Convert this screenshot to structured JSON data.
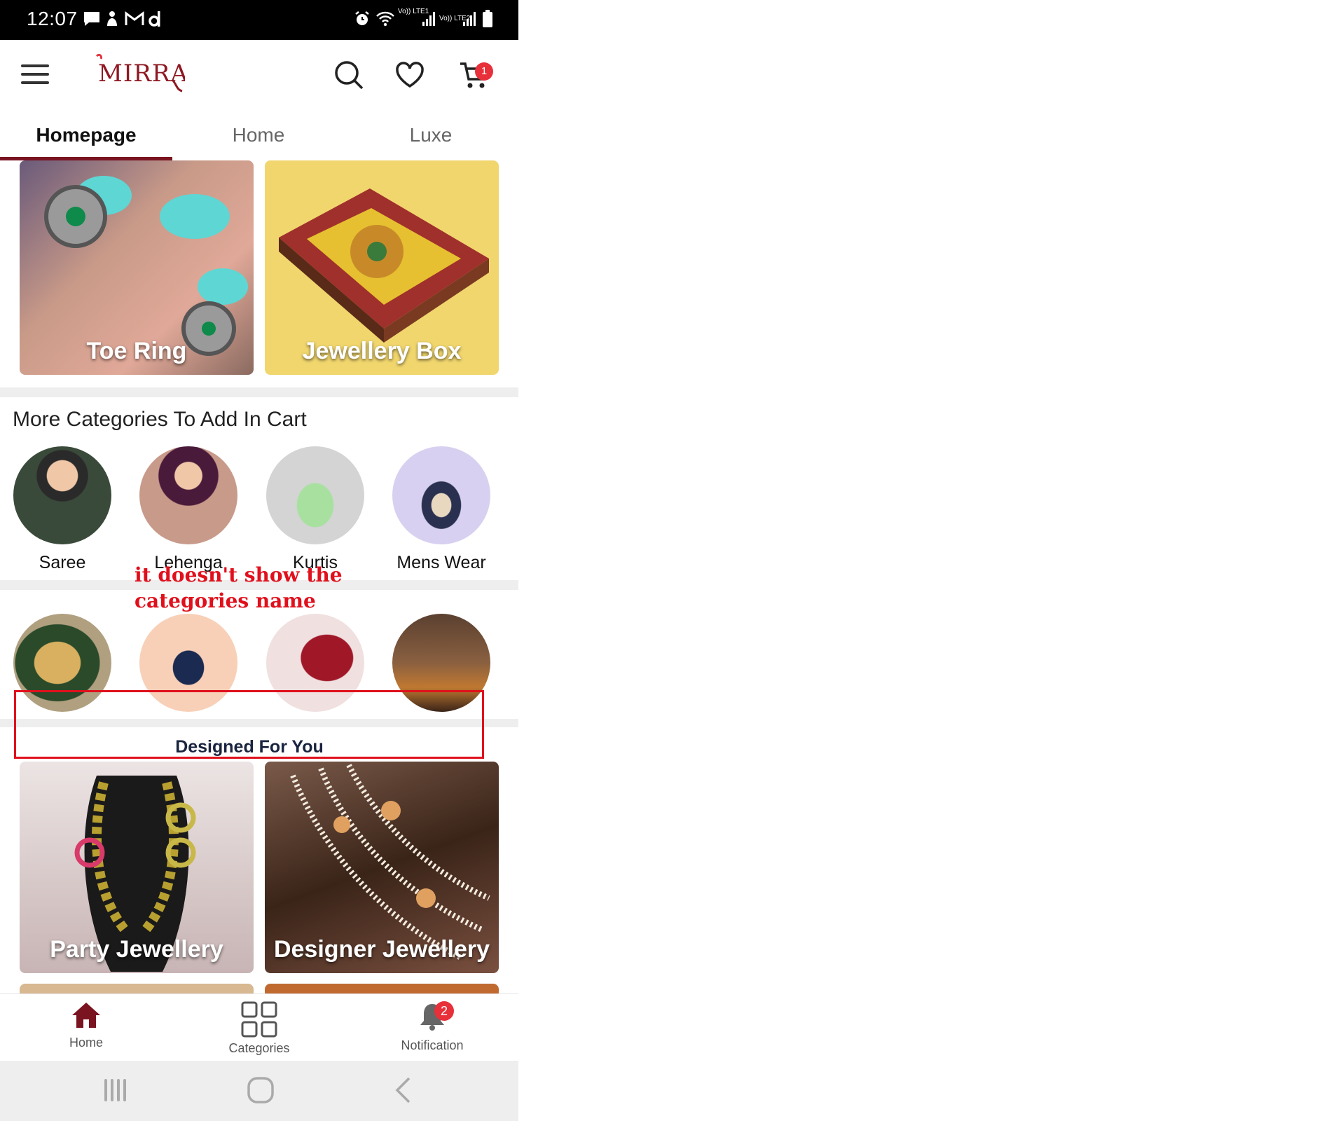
{
  "status_bar": {
    "time": "12:07",
    "signal_labels": [
      "Vo)) LTE1",
      "Vo)) LTE2"
    ]
  },
  "app_bar": {
    "logo_text": "MIRRAW",
    "cart_count": "1"
  },
  "tabs": [
    {
      "label": "Homepage",
      "active": true
    },
    {
      "label": "Home",
      "active": false
    },
    {
      "label": "Luxe",
      "active": false
    }
  ],
  "banners_top": [
    {
      "label": "Toe Ring"
    },
    {
      "label": "Jewellery Box"
    }
  ],
  "more_categories": {
    "title": "More Categories To Add In Cart",
    "row1": [
      {
        "label": "Saree"
      },
      {
        "label": "Lehenga"
      },
      {
        "label": "Kurtis"
      },
      {
        "label": "Mens Wear"
      }
    ]
  },
  "annotation": {
    "text": "it doesn't show the categories name",
    "color": "#e0101c"
  },
  "designed_section": {
    "title": "Designed For You"
  },
  "banners_bottom": [
    {
      "label": "Party Jewellery"
    },
    {
      "label": "Designer Jewellery"
    }
  ],
  "bottom_nav": [
    {
      "label": "Home",
      "icon": "home-icon",
      "active": true
    },
    {
      "label": "Categories",
      "icon": "grid-icon",
      "active": false
    },
    {
      "label": "Notification",
      "icon": "bell-icon",
      "active": false,
      "badge": "2"
    }
  ],
  "colors": {
    "brand": "#7a1420",
    "badge": "#e8303a",
    "annotation": "#e0101c"
  }
}
